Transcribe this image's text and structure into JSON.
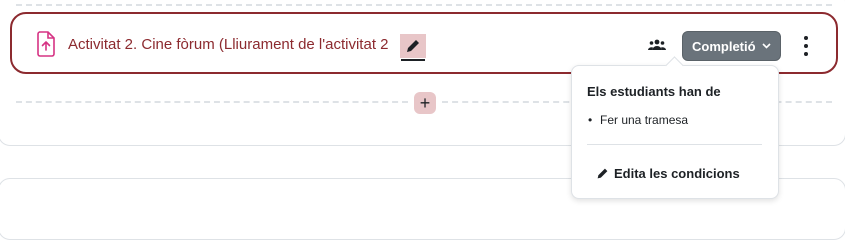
{
  "activity": {
    "title": "Activitat 2. Cine fòrum (Lliurament de l'activitat 2",
    "icon": "assignment-upload-icon",
    "completion_button_label": "Completió",
    "accent_color": "#8c2a2f"
  },
  "completion_dropdown": {
    "heading": "Els estudiants han de",
    "conditions": [
      "Fer una tramesa"
    ],
    "edit_conditions_label": "Edita les condicions"
  },
  "add_button_label": "+"
}
